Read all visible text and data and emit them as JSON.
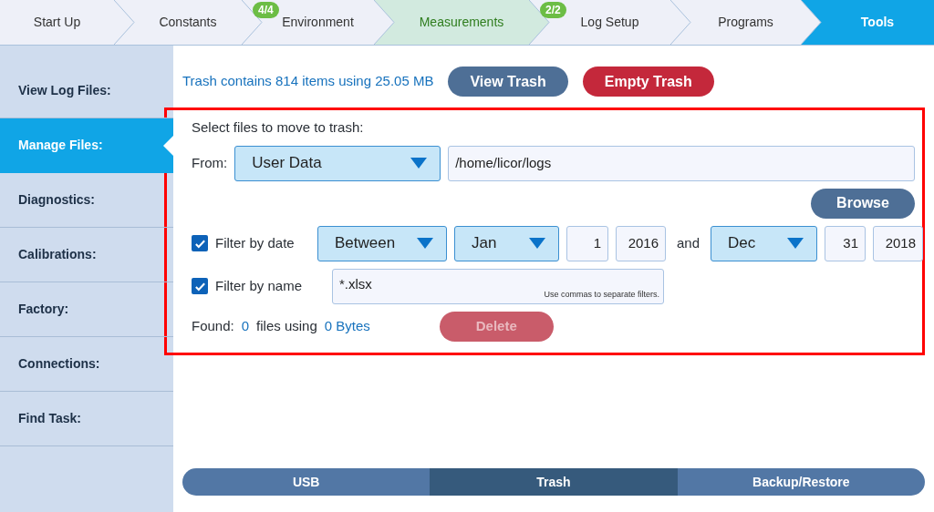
{
  "steps": [
    {
      "label": "Start Up",
      "complete": false,
      "selected": false
    },
    {
      "label": "Constants",
      "complete": false,
      "selected": false
    },
    {
      "label": "Environment",
      "badge": "4/4",
      "complete": false,
      "selected": false
    },
    {
      "label": "Measurements",
      "complete": true,
      "selected": false
    },
    {
      "label": "Log Setup",
      "badge": "2/2",
      "complete": false,
      "selected": false
    },
    {
      "label": "Programs",
      "complete": false,
      "selected": false
    },
    {
      "label": "Tools",
      "complete": false,
      "selected": true
    }
  ],
  "sidebar": {
    "items": [
      {
        "label": "View Log Files:",
        "selected": false
      },
      {
        "label": "Manage Files:",
        "selected": true
      },
      {
        "label": "Diagnostics:",
        "selected": false
      },
      {
        "label": "Calibrations:",
        "selected": false
      },
      {
        "label": "Factory:",
        "selected": false
      },
      {
        "label": "Connections:",
        "selected": false
      },
      {
        "label": "Find Task:",
        "selected": false
      }
    ]
  },
  "trash": {
    "summary": "Trash contains 814 items using 25.05 MB",
    "buttons": [
      {
        "label": "View Trash",
        "kind": "secondary"
      },
      {
        "label": "Empty Trash",
        "kind": "danger"
      }
    ]
  },
  "panel": {
    "highlighted": true,
    "heading": "Select files to move to trash:",
    "from": {
      "label": "From:",
      "source": "User Data",
      "path": "/home/licor/logs"
    },
    "browse": "Browse",
    "date_filter": {
      "label": "Filter by date",
      "checked": true,
      "mode": "Between",
      "start_month": "Jan",
      "start_day": "1",
      "start_year": "2016",
      "joiner": "and",
      "end_month": "Dec",
      "end_day": "31",
      "end_year": "2018"
    },
    "name_filter": {
      "label": "Filter by name",
      "checked": true,
      "value": "*.xlsx",
      "hint": "Use commas to separate filters."
    },
    "found": {
      "label": "Found:",
      "count": "0",
      "middle": "files using",
      "size": "0 Bytes"
    },
    "delete": {
      "label": "Delete",
      "disabled": true
    }
  },
  "bottom_tabs": [
    {
      "label": "USB",
      "selected": false
    },
    {
      "label": "Trash",
      "selected": true
    },
    {
      "label": "Backup/Restore",
      "selected": false
    }
  ]
}
